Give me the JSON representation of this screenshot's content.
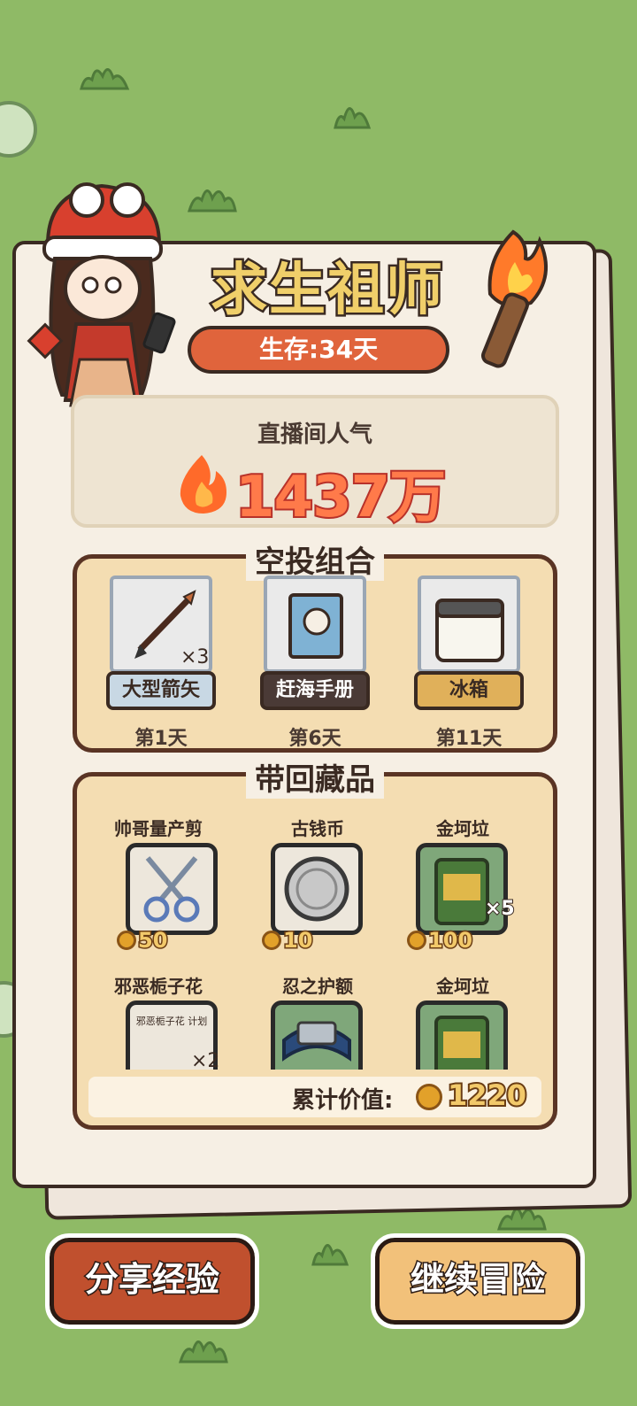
{
  "game": {
    "title": "求生祖师",
    "survival": "生存:34天",
    "popularity": {
      "label": "直播间人气",
      "value": "1437万"
    }
  },
  "airdrop": {
    "title": "空投组合",
    "items": [
      {
        "name": "大型箭矢",
        "quantity": "×3",
        "day": "第1天",
        "label_color": "#c8d8e4"
      },
      {
        "name": "赶海手册",
        "quantity": "",
        "day": "第6天",
        "label_color": "#4a3a36"
      },
      {
        "name": "冰箱",
        "quantity": "",
        "day": "第11天",
        "label_color": "#e0b05a"
      }
    ]
  },
  "collectibles": {
    "title": "带回藏品",
    "items": [
      {
        "name": "帅哥量产剪",
        "value": "50",
        "quantity": ""
      },
      {
        "name": "古钱币",
        "value": "10",
        "quantity": ""
      },
      {
        "name": "金坷垃",
        "value": "100",
        "quantity": "×5"
      },
      {
        "name": "邪恶栀子花",
        "value": "",
        "quantity": "×2",
        "poster_text": "邪恶栀子花 计划"
      },
      {
        "name": "忍之护额",
        "value": "",
        "quantity": ""
      },
      {
        "name": "金坷垃",
        "value": "",
        "quantity": ""
      }
    ],
    "total": {
      "label": "累计价值:",
      "value": "1220"
    }
  },
  "buttons": {
    "share": "分享经验",
    "continue": "继续冒险"
  },
  "colors": {
    "background": "#8fba66",
    "accent_orange": "#e0643c",
    "coin": "#e2a12a"
  }
}
